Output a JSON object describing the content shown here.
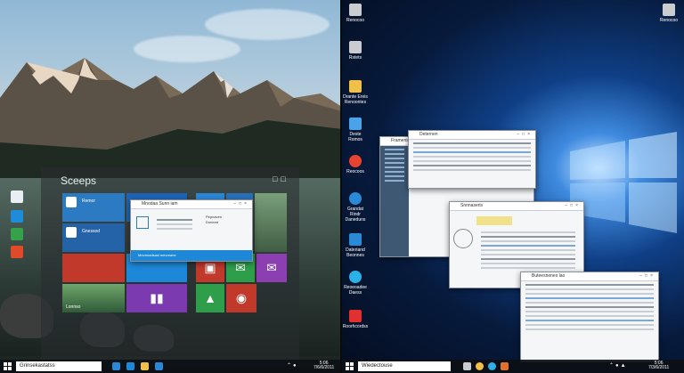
{
  "left_screen": {
    "start_menu": {
      "label": "Sceeps",
      "tiles": [
        {
          "title": "Remor",
          "text": "Senalne sed"
        },
        {
          "title": "Gnessod",
          "text": "Dreenmmne ons"
        },
        {
          "title": "",
          "text": "Lonnso"
        },
        {
          "title": "",
          "text": ""
        },
        {
          "title": "",
          "text": ""
        }
      ],
      "popup": {
        "title": "Mnodaa Sunn iam",
        "lines": [
          "Pepnacen",
          "Doneed"
        ],
        "bottom": "Mnonnadsasl mecreane"
      }
    },
    "desktop_icons": [
      {
        "icon": "sun-icon",
        "color": "#e8eef2"
      },
      {
        "icon": "window-icon",
        "color": "#1e8cd8"
      },
      {
        "icon": "shield-icon",
        "color": "#37a04a"
      },
      {
        "icon": "store-icon",
        "color": "#e04a2a"
      }
    ],
    "taskbar": {
      "search": "Grinsekastatss",
      "time": "5:06",
      "date": "7/6/6/2011"
    }
  },
  "right_screen": {
    "desktop_icons": [
      {
        "label": "Renocoo",
        "icon": "recycle-bin-icon",
        "color": "#c9cdd2"
      },
      {
        "label": "Rstets",
        "icon": "recycle-bin-icon",
        "color": "#c9cdd2"
      },
      {
        "label": "Drante Ereis Renoontes",
        "icon": "folder-icon",
        "color": "#f0c04a"
      },
      {
        "label": "Deste Romos",
        "icon": "computer-icon",
        "color": "#4aa3e8"
      },
      {
        "label": "Reocoos",
        "icon": "chrome-icon",
        "color": "#e8432e"
      },
      {
        "label": "Grandat Rindr Daneduns",
        "icon": "edge-icon",
        "color": "#2b8ad6"
      },
      {
        "label": "Dateriand Beonnes",
        "icon": "store-icon",
        "color": "#2b8ad6"
      },
      {
        "label": "Reoeoadee Daess",
        "icon": "edge-icon",
        "color": "#2bb0e8"
      },
      {
        "label": "Roorhcordss",
        "icon": "app-icon",
        "color": "#e03030"
      }
    ],
    "top_right_icon": {
      "label": "Renocoo",
      "icon": "recycle-bin-icon"
    },
    "windows": [
      {
        "title": "Framensen"
      },
      {
        "title": "Deternen"
      },
      {
        "title": "Snnnaseris"
      },
      {
        "title": "Buteesnenes lao"
      }
    ],
    "taskbar": {
      "search": "Wiedectouse",
      "time": "5:06",
      "date": "7/3/6/2011"
    }
  }
}
